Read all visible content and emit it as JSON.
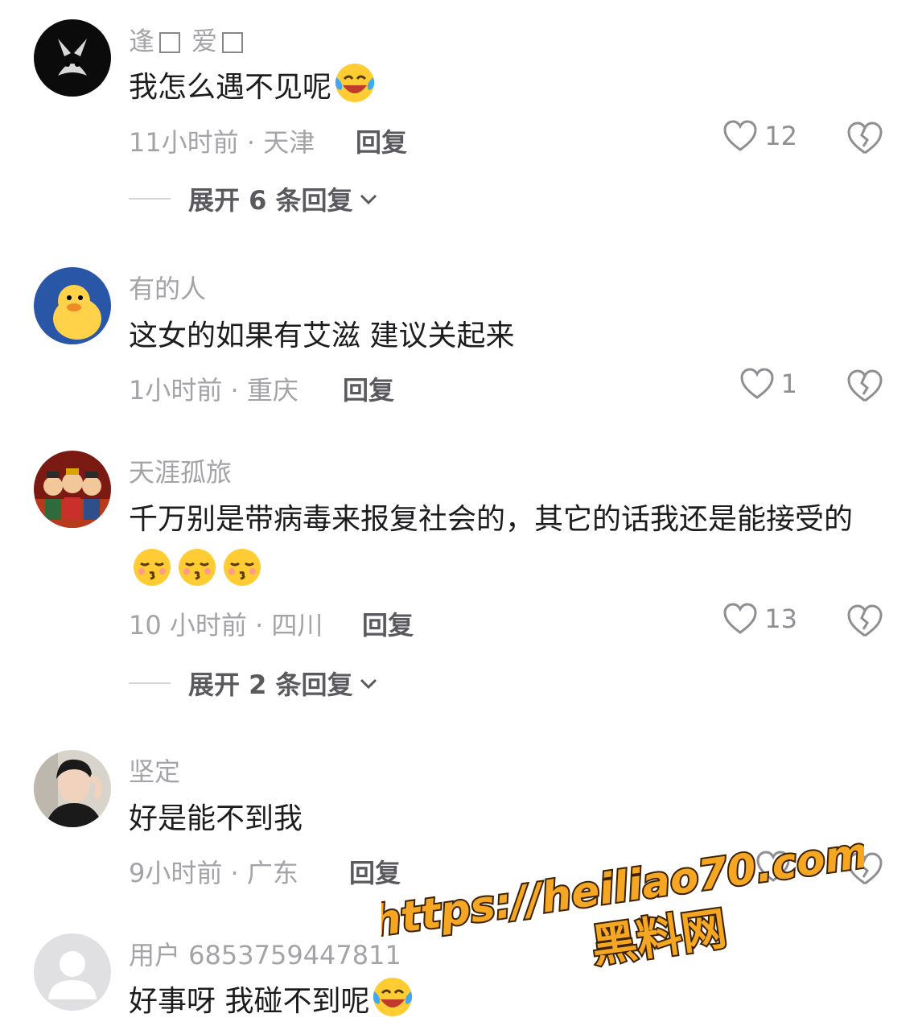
{
  "comments": [
    {
      "username_parts": [
        "逢",
        "爱"
      ],
      "text": "我怎么遇不见呢",
      "emoji": "laughing-crying-emoji",
      "time": "11小时前",
      "location": "天津",
      "reply_label": "回复",
      "likes": "12",
      "expand_label": "展开 6 条回复"
    },
    {
      "username": "有的人",
      "text": "这女的如果有艾滋 建议关起来",
      "time": "1小时前",
      "location": "重庆",
      "reply_label": "回复",
      "likes": "1"
    },
    {
      "username": "天涯孤旅",
      "text": "千万别是带病毒来报复社会的，其它的话我还是能接受的",
      "emoji": "kissing-face-emoji",
      "time": "10 小时前",
      "location": "四川",
      "reply_label": "回复",
      "likes": "13",
      "expand_label": "展开 2 条回复"
    },
    {
      "username": "坚定",
      "text": "好是能不到我",
      "time": "9小时前",
      "location": "广东",
      "reply_label": "回复"
    },
    {
      "username": "用户 6853759447811",
      "text": "好事呀 我碰不到呢",
      "emoji": "laughing-crying-emoji"
    }
  ],
  "meta_separator": " · ",
  "watermark": {
    "line1": "https://heiliao70.com",
    "line2": "黑料网",
    "fill": "#f5a623",
    "stroke": "#3a2200"
  },
  "colors": {
    "text": "#1c1c1e",
    "muted": "#a3a3a8",
    "action": "#5a5a5e"
  }
}
